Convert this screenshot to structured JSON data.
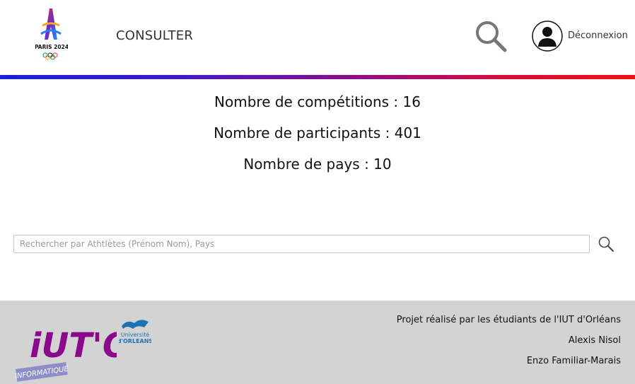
{
  "header": {
    "logo_text": "PARIS 2024",
    "nav_consulter": "CONSULTER",
    "logout": "Déconnexion"
  },
  "stats": {
    "competitions": "Nombre de compétitions : 16",
    "participants": "Nombre de participants : 401",
    "pays": "Nombre de pays : 10"
  },
  "search": {
    "placeholder": "Rechercher par Athtlètes (Prénom Nom), Pays",
    "value": ""
  },
  "footer": {
    "iut_logo_text": "iUT'O",
    "iut_informatique": "INFORMATIQUE",
    "univ_logo_line1": "Université",
    "univ_logo_line2": "d'ORLEANS",
    "credits_line1": "Projet réalisé par les étudiants de l'IUT d'Orléans",
    "credits_line2": "Alexis Nisol",
    "credits_line3": "Enzo Familiar-Marais"
  },
  "colors": {
    "tricolor_start": "#1a21d6",
    "tricolor_end": "#ee1111",
    "iut_purple": "#8b0a8b",
    "footer_bg": "#d3d3d3"
  }
}
